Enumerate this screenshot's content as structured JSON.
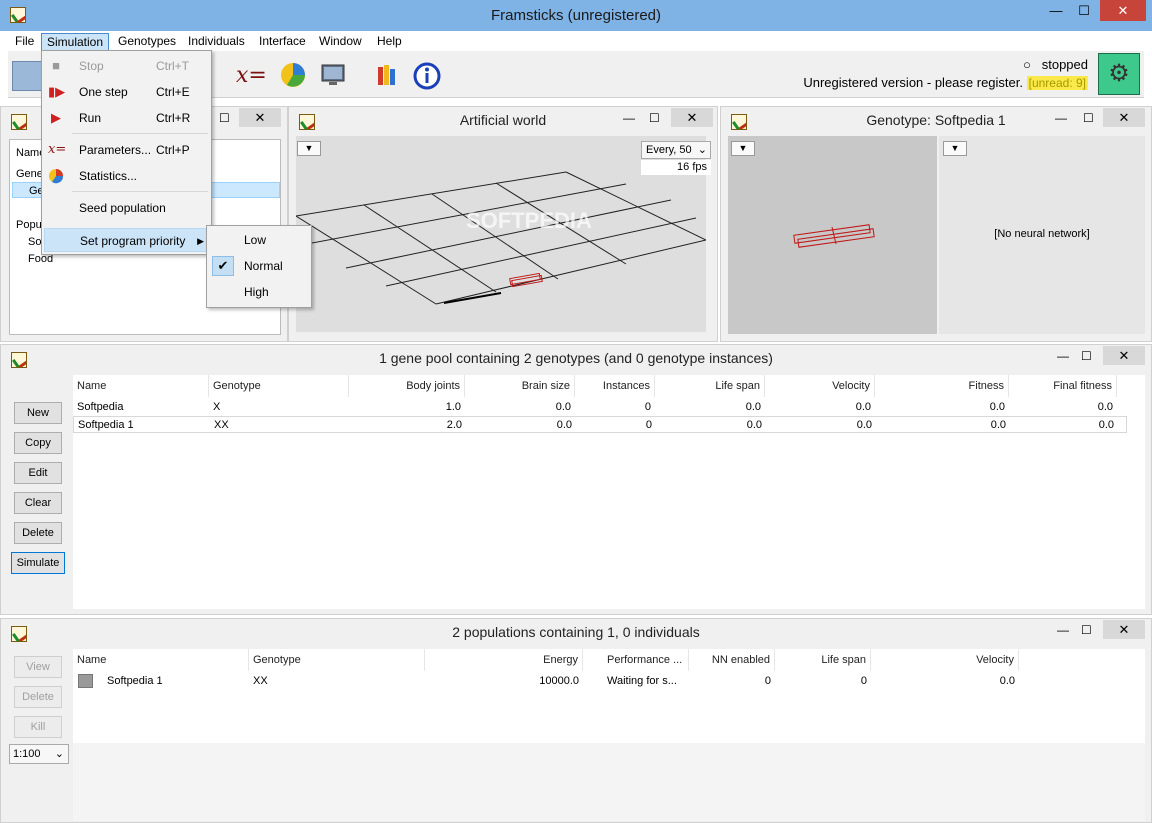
{
  "window": {
    "title": "Framsticks (unregistered)",
    "minimize": "—",
    "maximize": "☐",
    "close": "✕"
  },
  "menubar": [
    "File",
    "Simulation",
    "Genotypes",
    "Individuals",
    "Interface",
    "Window",
    "Help"
  ],
  "toolbar": {
    "status": "stopped",
    "register": "Unregistered version - please register.",
    "unread": "[unread: 9]"
  },
  "simulation_menu": {
    "items": [
      {
        "label": "Stop",
        "shortcut": "Ctrl+T",
        "icon": "stop-icon",
        "disabled": true
      },
      {
        "label": "One step",
        "shortcut": "Ctrl+E",
        "icon": "step-icon"
      },
      {
        "label": "Run",
        "shortcut": "Ctrl+R",
        "icon": "play-icon"
      },
      {
        "label": "Parameters...",
        "shortcut": "Ctrl+P",
        "icon": "formula-icon"
      },
      {
        "label": "Statistics...",
        "shortcut": "",
        "icon": "pie-icon"
      },
      {
        "label": "Seed population",
        "shortcut": ""
      },
      {
        "label": "Set program priority",
        "shortcut": "",
        "submenu": true
      }
    ]
  },
  "priority_menu": {
    "items": [
      "Low",
      "Normal",
      "High"
    ],
    "checked": "Normal"
  },
  "tree_panel": {
    "header": "Name",
    "items": [
      "Gene",
      "Ge",
      "Popu",
      "So",
      "Food"
    ]
  },
  "world_panel": {
    "title": "Artificial world",
    "speed": "Every, 50",
    "fps": "16 fps",
    "watermark": "SOFTPEDIA"
  },
  "genotype_panel": {
    "title": "Genotype: Softpedia 1",
    "neural": "[No neural network]"
  },
  "genepool_panel": {
    "title": "1 gene pool containing 2 genotypes (and 0 genotype instances)",
    "buttons": [
      "New",
      "Copy",
      "Edit",
      "Clear",
      "Delete",
      "Simulate"
    ],
    "columns": [
      "Name",
      "Genotype",
      "Body joints",
      "Brain size",
      "Instances",
      "Life span",
      "Velocity",
      "Fitness",
      "Final fitness"
    ],
    "rows": [
      [
        "Softpedia",
        "X",
        "1.0",
        "0.0",
        "0",
        "0.0",
        "0.0",
        "0.0",
        "0.0"
      ],
      [
        "Softpedia 1",
        "XX",
        "2.0",
        "0.0",
        "0",
        "0.0",
        "0.0",
        "0.0",
        "0.0"
      ]
    ]
  },
  "population_panel": {
    "title": "2 populations containing 1, 0 individuals",
    "buttons": [
      "View",
      "Delete",
      "Kill"
    ],
    "zoom": "1:100",
    "columns": [
      "Name",
      "Genotype",
      "Energy",
      "Performance ...",
      "NN enabled",
      "Life span",
      "Velocity"
    ],
    "rows": [
      [
        "Softpedia 1",
        "XX",
        "10000.0",
        "Waiting for s...",
        "0",
        "0",
        "0.0"
      ]
    ]
  }
}
